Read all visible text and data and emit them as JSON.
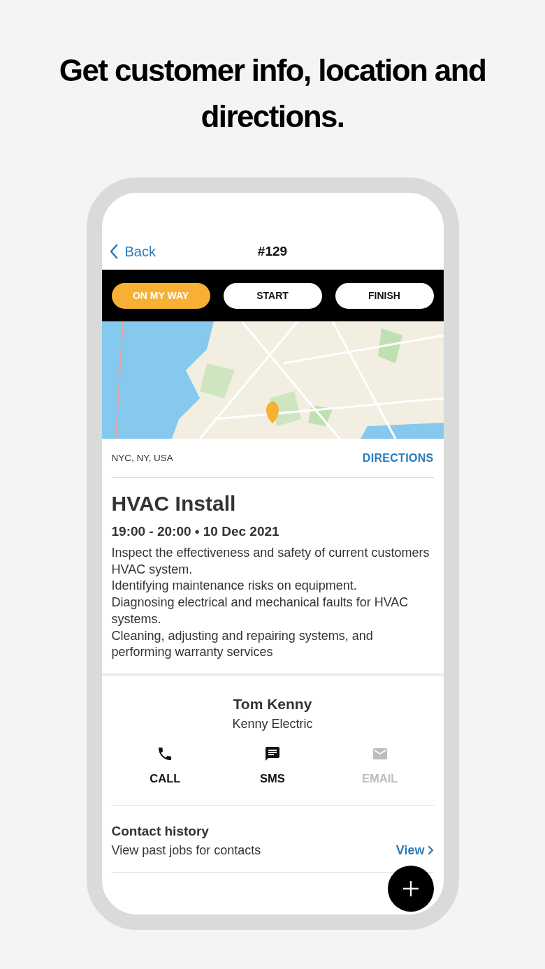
{
  "headline": "Get customer info, location and directions.",
  "nav": {
    "back": "Back",
    "title": "#129"
  },
  "status_buttons": [
    {
      "label": "ON MY WAY",
      "selected": true
    },
    {
      "label": "START",
      "selected": false
    },
    {
      "label": "FINISH",
      "selected": false
    }
  ],
  "address": {
    "text": "NYC, NY, USA",
    "link": "DIRECTIONS"
  },
  "job": {
    "title": "HVAC Install",
    "time": "19:00 - 20:00 • 10 Dec 2021",
    "description": [
      "Inspect the effectiveness and safety of current customers HVAC system.",
      "Identifying maintenance risks on equipment.",
      "Diagnosing electrical and mechanical faults for HVAC systems.",
      "Cleaning, adjusting and repairing systems, and performing warranty services"
    ]
  },
  "contact": {
    "name": "Tom Kenny",
    "company": "Kenny Electric",
    "actions": [
      {
        "kind": "call",
        "label": "CALL",
        "disabled": false
      },
      {
        "kind": "sms",
        "label": "SMS",
        "disabled": false
      },
      {
        "kind": "email",
        "label": "EMAIL",
        "disabled": true
      }
    ]
  },
  "history": {
    "title": "Contact history",
    "subtitle": "View past jobs for contacts",
    "link": "View"
  }
}
